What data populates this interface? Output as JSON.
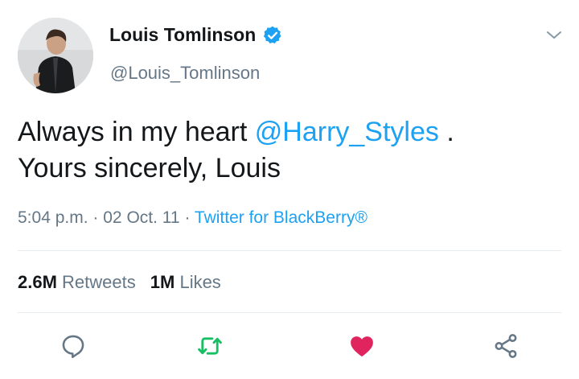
{
  "tweet": {
    "author_name": "Louis Tomlinson",
    "author_handle": "@Louis_Tomlinson",
    "text_before_mention": "Always in my heart ",
    "mention": "@Harry_Styles",
    "text_after_mention": " .",
    "text_line2": "Yours sincerely, Louis",
    "time": "5:04 p.m.",
    "separator": "·",
    "date": "02 Oct. 11",
    "source": "Twitter for BlackBerry®"
  },
  "stats": {
    "retweets_count": "2.6M",
    "retweets_label": "Retweets",
    "likes_count": "1M",
    "likes_label": "Likes"
  },
  "icons": {
    "verified": "verified-badge-icon",
    "menu": "chevron-down-icon",
    "reply": "reply-icon",
    "retweet": "retweet-icon",
    "like": "heart-icon",
    "share": "share-icon"
  },
  "colors": {
    "link": "#1da1f2",
    "secondary_text": "#657786",
    "retweet_active": "#17bf63",
    "like_active": "#e0245e"
  }
}
